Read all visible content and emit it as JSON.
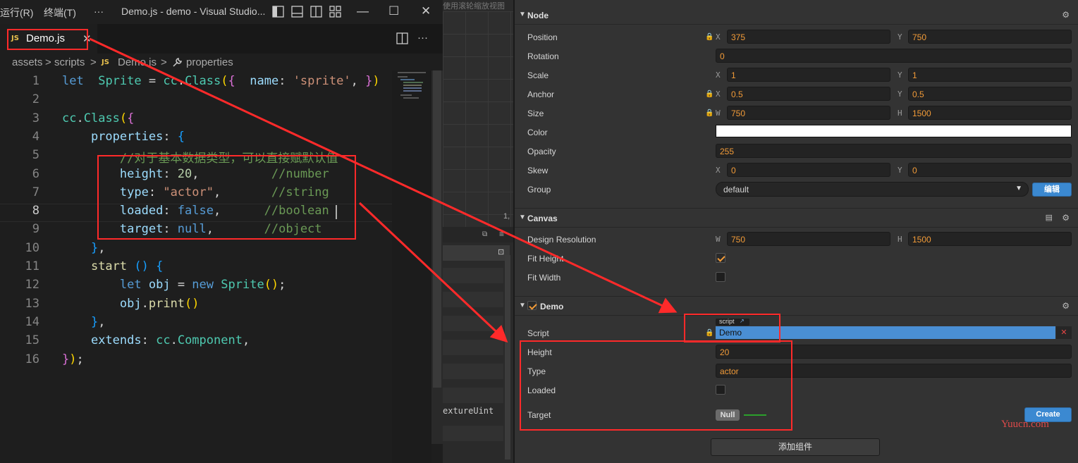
{
  "titlebar": {
    "menu_run": "运行(R)",
    "menu_terminal": "终端(T)",
    "menu_more": "···",
    "window_title": "Demo.js - demo - Visual Studio...",
    "minimize": "—",
    "maximize": "☐",
    "close": "✕"
  },
  "editor_tab": {
    "icon": "JS",
    "label": "Demo.js",
    "close": "✕",
    "split_icon": "split-editor-icon",
    "more": "···"
  },
  "breadcrumb": {
    "items": [
      "assets",
      "scripts",
      "Demo.js",
      "properties"
    ],
    "sep": ">",
    "file_icon": "JS",
    "prop_icon": "wrench-icon"
  },
  "code": {
    "line_numbers": [
      "1",
      "2",
      "3",
      "4",
      "5",
      "6",
      "7",
      "8",
      "9",
      "10",
      "11",
      "12",
      "13",
      "14",
      "15",
      "16"
    ],
    "lines": [
      [
        [
          "kw",
          "let"
        ],
        [
          "",
          "  "
        ],
        [
          "cls",
          "Sprite"
        ],
        [
          "",
          " = "
        ],
        [
          "cls",
          "cc"
        ],
        [
          "",
          "."
        ],
        [
          "cls",
          "Class"
        ],
        [
          "b1",
          "("
        ],
        [
          "b2",
          "{"
        ],
        [
          "",
          "  "
        ],
        [
          "prop",
          "name"
        ],
        [
          "",
          ": "
        ],
        [
          "str",
          "'sprite'"
        ],
        [
          "",
          ", "
        ],
        [
          "b2",
          "}"
        ],
        [
          "b1",
          ")"
        ]
      ],
      [],
      [
        [
          "cls",
          "cc"
        ],
        [
          "",
          "."
        ],
        [
          "cls",
          "Class"
        ],
        [
          "b1",
          "("
        ],
        [
          "b2",
          "{"
        ]
      ],
      [
        [
          "",
          "    "
        ],
        [
          "prop",
          "properties"
        ],
        [
          "",
          ": "
        ],
        [
          "b3",
          "{"
        ]
      ],
      [
        [
          "",
          "        "
        ],
        [
          "cmt",
          "//对于基本数据类型，可以直接赋默认值"
        ]
      ],
      [
        [
          "",
          "        "
        ],
        [
          "prop",
          "height"
        ],
        [
          "",
          ": "
        ],
        [
          "num",
          "20"
        ],
        [
          "",
          ",          "
        ],
        [
          "cmt",
          "//number"
        ]
      ],
      [
        [
          "",
          "        "
        ],
        [
          "prop",
          "type"
        ],
        [
          "",
          ": "
        ],
        [
          "str",
          "\"actor\""
        ],
        [
          "",
          ",       "
        ],
        [
          "cmt",
          "//string"
        ]
      ],
      [
        [
          "",
          "        "
        ],
        [
          "prop",
          "loaded"
        ],
        [
          "",
          ": "
        ],
        [
          "kw",
          "false"
        ],
        [
          "",
          ",      "
        ],
        [
          "cmt",
          "//boolean"
        ]
      ],
      [
        [
          "",
          "        "
        ],
        [
          "prop",
          "target"
        ],
        [
          "",
          ": "
        ],
        [
          "kw",
          "null"
        ],
        [
          "",
          ",       "
        ],
        [
          "cmt",
          "//object"
        ]
      ],
      [
        [
          "",
          "    "
        ],
        [
          "b3",
          "}"
        ],
        [
          "",
          ","
        ]
      ],
      [
        [
          "",
          "    "
        ],
        [
          "fn",
          "start"
        ],
        [
          "",
          " "
        ],
        [
          "b3",
          "()"
        ],
        [
          "",
          " "
        ],
        [
          "b3",
          "{"
        ]
      ],
      [
        [
          "",
          "        "
        ],
        [
          "kw",
          "let"
        ],
        [
          "",
          " "
        ],
        [
          "prop",
          "obj"
        ],
        [
          "",
          " = "
        ],
        [
          "kw",
          "new"
        ],
        [
          "",
          " "
        ],
        [
          "cls",
          "Sprite"
        ],
        [
          "b1",
          "()"
        ],
        [
          "",
          ";"
        ]
      ],
      [
        [
          "",
          "        "
        ],
        [
          "prop",
          "obj"
        ],
        [
          "",
          "."
        ],
        [
          "fn",
          "print"
        ],
        [
          "b1",
          "()"
        ]
      ],
      [
        [
          "",
          "    "
        ],
        [
          "b3",
          "}"
        ],
        [
          "",
          ","
        ]
      ],
      [
        [
          "",
          "    "
        ],
        [
          "prop",
          "extends"
        ],
        [
          "",
          ": "
        ],
        [
          "cls",
          "cc"
        ],
        [
          "",
          "."
        ],
        [
          "cls",
          "Component"
        ],
        [
          "",
          ","
        ]
      ],
      [
        [
          "b2",
          "}"
        ],
        [
          "b1",
          ")"
        ],
        [
          "",
          ";"
        ]
      ]
    ]
  },
  "scene": {
    "hint": "使用滚轮缩放视图",
    "coord": "1,",
    "texture_text": "extureUint"
  },
  "inspector": {
    "node": {
      "title": "Node",
      "position": {
        "label": "Position",
        "x_axis": "X",
        "x": "375",
        "y_axis": "Y",
        "y": "750"
      },
      "rotation": {
        "label": "Rotation",
        "value": "0"
      },
      "scale": {
        "label": "Scale",
        "x_axis": "X",
        "x": "1",
        "y_axis": "Y",
        "y": "1"
      },
      "anchor": {
        "label": "Anchor",
        "x_axis": "X",
        "x": "0.5",
        "y_axis": "Y",
        "y": "0.5"
      },
      "size": {
        "label": "Size",
        "w_axis": "W",
        "w": "750",
        "h_axis": "H",
        "h": "1500"
      },
      "color": {
        "label": "Color",
        "value": "#ffffff"
      },
      "opacity": {
        "label": "Opacity",
        "value": "255"
      },
      "skew": {
        "label": "Skew",
        "x_axis": "X",
        "x": "0",
        "y_axis": "Y",
        "y": "0"
      },
      "group": {
        "label": "Group",
        "value": "default",
        "edit_button": "编辑"
      }
    },
    "canvas": {
      "title": "Canvas",
      "design_resolution": {
        "label": "Design Resolution",
        "w_axis": "W",
        "w": "750",
        "h_axis": "H",
        "h": "1500"
      },
      "fit_height": {
        "label": "Fit Height",
        "checked": true
      },
      "fit_width": {
        "label": "Fit Width",
        "checked": false
      }
    },
    "demo": {
      "title": "Demo",
      "enabled": true,
      "script": {
        "label": "Script",
        "tag": "script",
        "value": "Demo",
        "remove": "✕"
      },
      "height": {
        "label": "Height",
        "value": "20"
      },
      "type": {
        "label": "Type",
        "value": "actor"
      },
      "loaded": {
        "label": "Loaded",
        "checked": false
      },
      "target": {
        "label": "Target",
        "null_badge": "Null",
        "create_button": "Create"
      }
    },
    "add_component": "添加组件",
    "watermark": "Yuucn.com"
  },
  "colors": {
    "annotation_red": "#ff2a2a",
    "accent_orange": "#f29b38",
    "button_blue": "#3b89d1",
    "script_field_blue": "#4a8fd4"
  }
}
